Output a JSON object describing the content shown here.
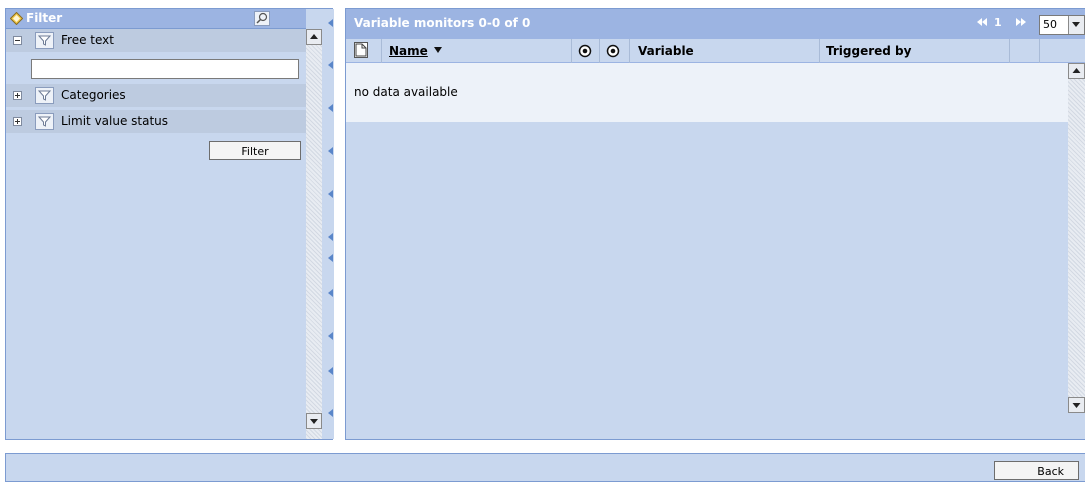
{
  "filter": {
    "title": "Filter",
    "sections": [
      {
        "label": "Free text",
        "expanded": true,
        "icon": "funnel-icon"
      },
      {
        "label": "Categories",
        "expanded": false,
        "icon": "funnel-icon"
      },
      {
        "label": "Limit value status",
        "expanded": false,
        "icon": "funnel-icon"
      }
    ],
    "free_text_value": "",
    "filter_button": "Filter"
  },
  "main": {
    "title": "Variable monitors 0-0 of 0",
    "pager": {
      "page": "1",
      "page_size": "50"
    },
    "columns": {
      "name": "Name",
      "variable": "Variable",
      "triggered_by": "Triggered by"
    },
    "empty_message": "no data available"
  },
  "footer": {
    "back_button": "Back"
  },
  "colors": {
    "panel_bg": "#c8d7ee",
    "header_bg": "#9cb4e2",
    "border": "#7c9bd1",
    "row_bg": "#edf2f9"
  }
}
